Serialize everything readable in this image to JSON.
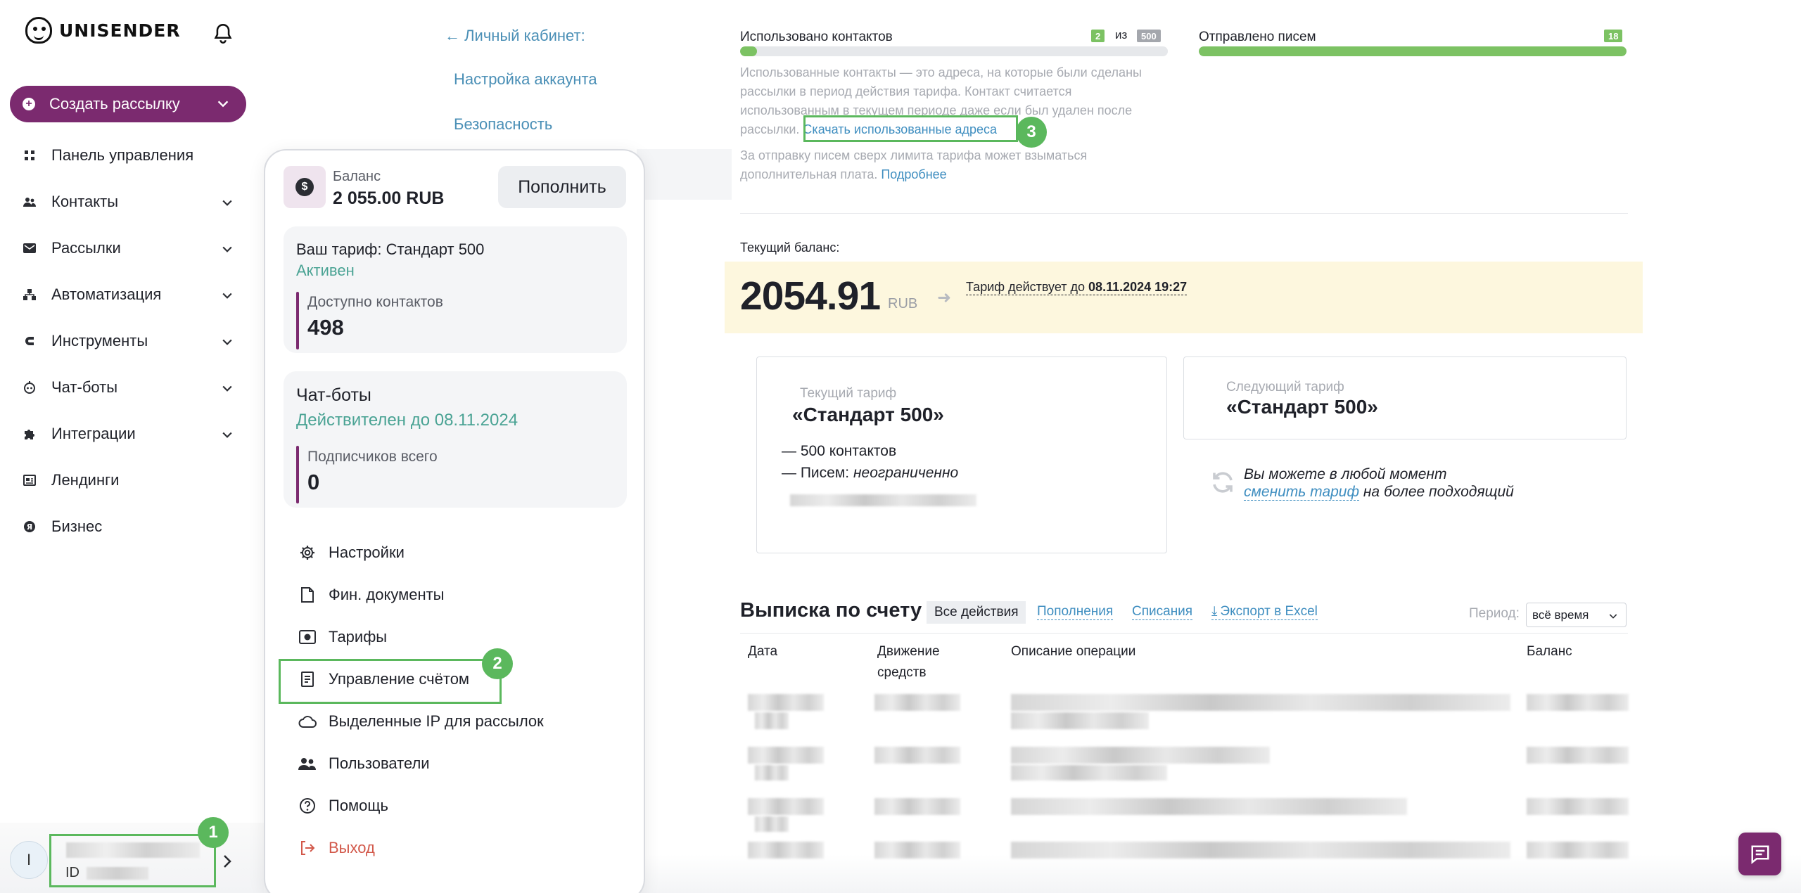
{
  "sidebar": {
    "logo_text": "UNISENDER",
    "create_label": "Создать рассылку",
    "items": [
      {
        "label": "Панель управления"
      },
      {
        "label": "Контакты"
      },
      {
        "label": "Рассылки"
      },
      {
        "label": "Автоматизация"
      },
      {
        "label": "Инструменты"
      },
      {
        "label": "Чат-боты"
      },
      {
        "label": "Интеграции"
      },
      {
        "label": "Лендинги"
      },
      {
        "label": "Бизнес"
      }
    ],
    "user": {
      "avatar_letter": "I",
      "id_prefix": "ID"
    }
  },
  "account_nav": {
    "back": "← Личный кабинет:",
    "links": [
      "Настройка аккаунта",
      "Безопасность"
    ]
  },
  "popup": {
    "balance_label": "Баланс",
    "balance_value": "2 055.00 RUB",
    "topup": "Пополнить",
    "tariff": {
      "title": "Ваш тариф: Стандарт 500",
      "status": "Активен",
      "available_label": "Доступно контактов",
      "available_value": "498"
    },
    "chatbots": {
      "title": "Чат-боты",
      "status": "Действителен до 08.11.2024",
      "subs_label": "Подписчиков всего",
      "subs_value": "0"
    },
    "menu": [
      "Настройки",
      "Фин. документы",
      "Тарифы",
      "Управление счётом",
      "Выделенные IP для рассылок",
      "Пользователи",
      "Помощь",
      "Выход"
    ]
  },
  "usage": {
    "contacts_label": "Использовано контактов",
    "contacts_used": "2",
    "contacts_of": "из",
    "contacts_total": "500",
    "contacts_progress": 0.04,
    "letters_label": "Отправлено писем",
    "letters_count": "18",
    "letters_progress": 1.0,
    "note_lines": [
      "Использованные контакты — это адреса, на которые были сделаны",
      "рассылки в период действия тарифа. Контакт считается",
      "использованным в текущем периоде даже если был удален после"
    ],
    "note_last_prefix": "рассылки.",
    "download_link": "Скачать использованные адреса",
    "extra_line1": "За отправку писем сверх лимита тарифа может взыматься",
    "extra_line2": "дополнительная плата.",
    "more_link": "Подробнее"
  },
  "balance": {
    "label": "Текущий баланс:",
    "value": "2054.91",
    "currency": "RUB",
    "until_prefix": "Тариф действует до",
    "until_date": "08.11.2024 19:27"
  },
  "current_tariff": {
    "label": "Текущий тариф",
    "name": "«Стандарт 500»",
    "line1": "— 500 контактов",
    "line2_prefix": "— Писем:",
    "line2_value": "неограниченно"
  },
  "next_tariff": {
    "label": "Следующий тариф",
    "name": "«Стандарт 500»"
  },
  "change_note": {
    "line1": "Вы можете в любой момент",
    "link": "сменить тариф",
    "line2_suffix": "на более подходящий"
  },
  "statement": {
    "title": "Выписка по счету",
    "tabs": [
      "Все действия",
      "Пополнения",
      "Списания",
      "Экспорт в Excel"
    ],
    "period_label": "Период:",
    "period_value": "всё время",
    "headers": [
      "Дата",
      "Движение средств",
      "Описание операции",
      "Баланс"
    ]
  },
  "badges": [
    "1",
    "2",
    "3"
  ],
  "colors": {
    "brand": "#7b2a6f",
    "accent_green": "#5bb85d",
    "link": "#3f8ec0",
    "status_green": "#4aa394",
    "band": "#fdf7de"
  }
}
